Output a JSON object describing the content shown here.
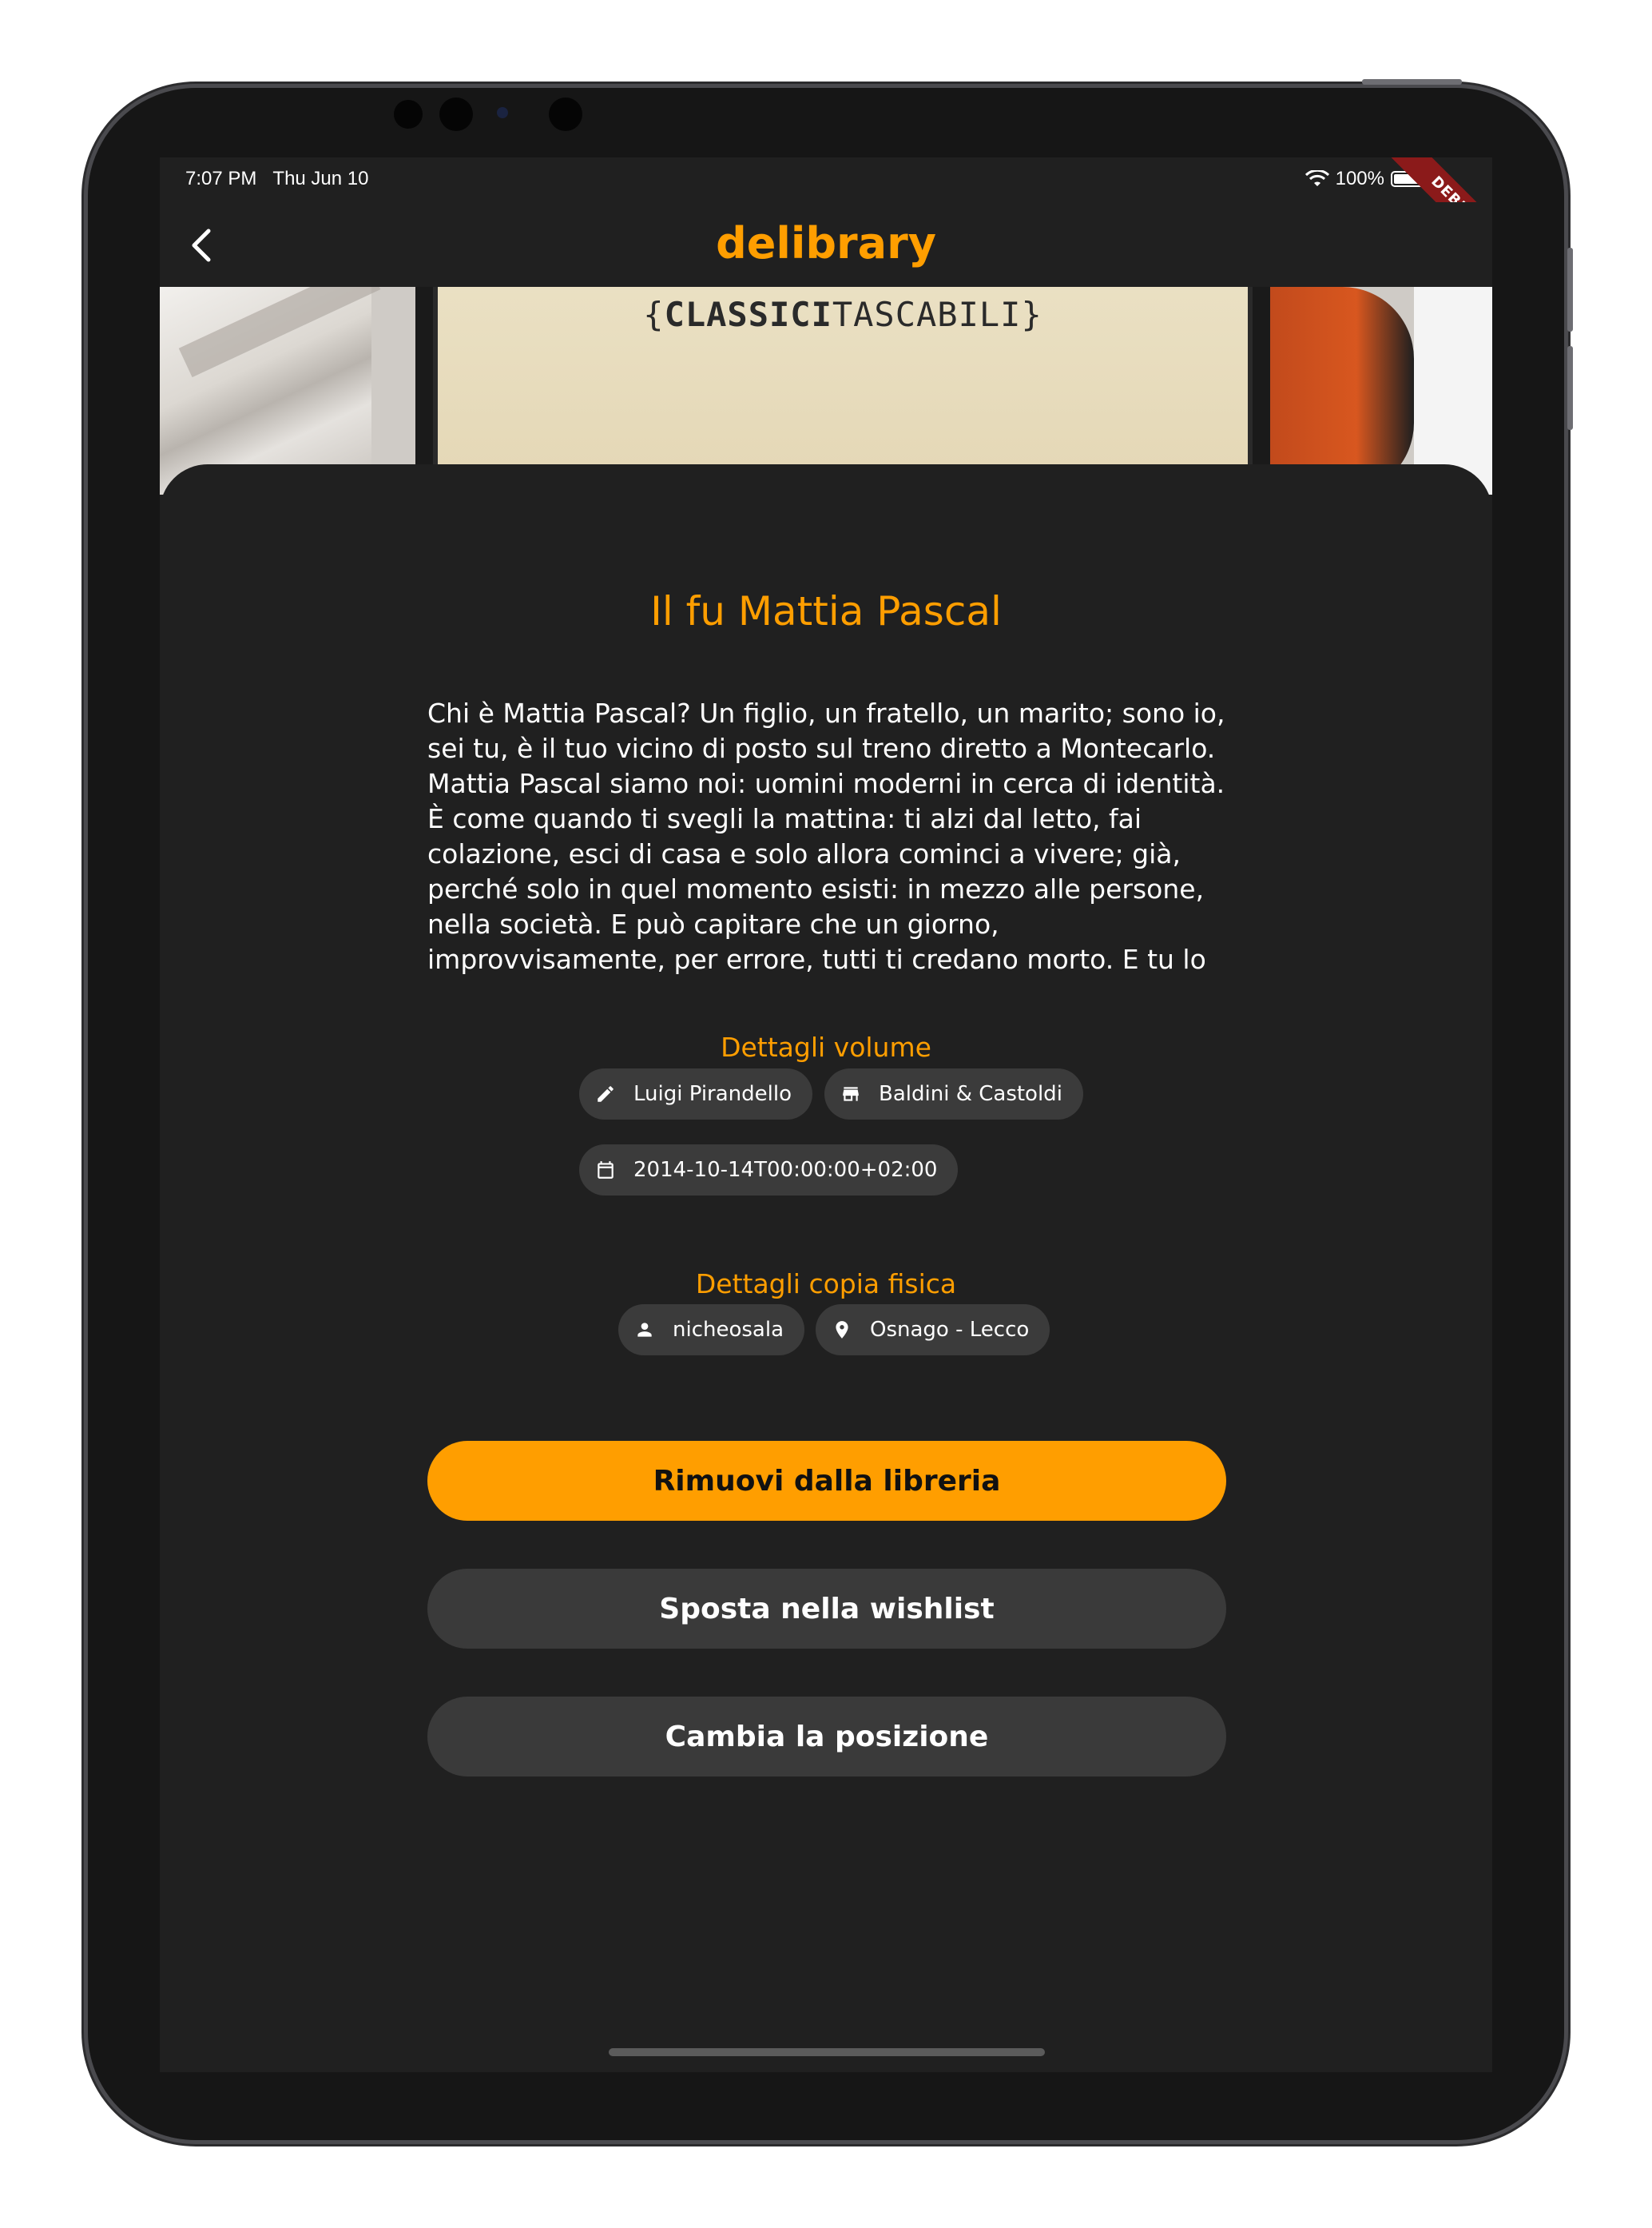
{
  "status_bar": {
    "time": "7:07 PM",
    "date": "Thu Jun 10",
    "battery": "100%",
    "debug_label": "DEBUG"
  },
  "app_bar": {
    "title": "delibrary",
    "back_icon": "chevron-left-icon"
  },
  "cover": {
    "brand_bold": "CLASSICI",
    "brand_light": "TASCABILI",
    "brand_open": "{",
    "brand_close": "}"
  },
  "book": {
    "title": "Il fu Mattia Pascal",
    "description": "Chi è Mattia Pascal? Un figlio, un fratello, un marito; sono io, sei tu, è il tuo vicino di posto sul treno diretto a Montecarlo. Mattia Pascal siamo noi: uomini moderni in cerca di identità. È come quando ti svegli la mattina: ti alzi dal letto, fai colazione, esci di casa e solo allora cominci a vivere; già, perché solo in quel momento esisti: in mezzo alle persone, nella società. E può capitare che un giorno, improvvisamente, per errore, tutti ti credano morto. E tu lo scopri e dopo un attimo di smarrimento ..."
  },
  "volume_details": {
    "title": "Dettagli volume",
    "author": "Luigi Pirandello",
    "publisher": "Baldini & Castoldi",
    "published_date": "2014-10-14T00:00:00+02:00",
    "icons": [
      "pencil-icon",
      "store-icon",
      "calendar-icon"
    ]
  },
  "copy_details": {
    "title": "Dettagli copia fisica",
    "owner": "nicheosala",
    "location": "Osnago - Lecco",
    "icons": [
      "person-icon",
      "location-pin-icon"
    ]
  },
  "actions": {
    "remove": "Rimuovi dalla libreria",
    "move_wishlist": "Sposta nella wishlist",
    "change_position": "Cambia la posizione"
  },
  "colors": {
    "accent": "#ff9e00",
    "background": "#202020",
    "chip": "#3b3b3b",
    "secondary_button": "#3a3a3a"
  }
}
